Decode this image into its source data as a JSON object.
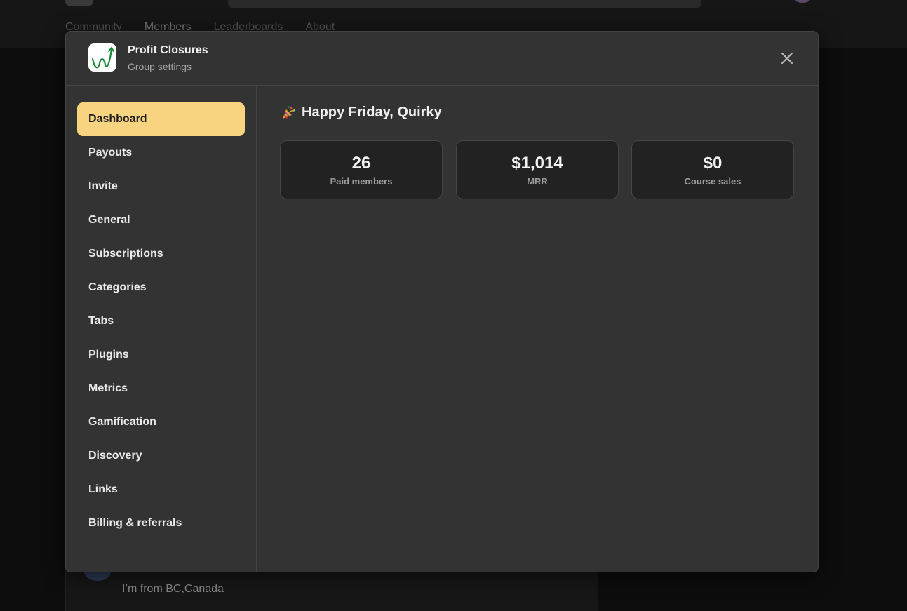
{
  "background": {
    "tabs": [
      "Community",
      "Members",
      "Leaderboards",
      "About"
    ],
    "post_text": "I’m from BC,Canada"
  },
  "modal": {
    "group_name": "Profit Closures",
    "subtitle": "Group settings",
    "close_icon": "close-icon"
  },
  "sidebar": {
    "items": [
      {
        "label": "Dashboard",
        "active": true
      },
      {
        "label": "Payouts"
      },
      {
        "label": "Invite"
      },
      {
        "label": "General"
      },
      {
        "label": "Subscriptions"
      },
      {
        "label": "Categories"
      },
      {
        "label": "Tabs"
      },
      {
        "label": "Plugins"
      },
      {
        "label": "Metrics"
      },
      {
        "label": "Gamification"
      },
      {
        "label": "Discovery"
      },
      {
        "label": "Links"
      },
      {
        "label": "Billing & referrals"
      }
    ]
  },
  "dashboard": {
    "greeting": "Happy Friday, Quirky",
    "greeting_icon": "party-popper-icon",
    "stats": [
      {
        "value": "26",
        "label": "Paid members"
      },
      {
        "value": "$1,014",
        "label": "MRR"
      },
      {
        "value": "$0",
        "label": "Course sales"
      }
    ]
  },
  "colors": {
    "active_nav": "#f8d481",
    "modal_bg": "#333333",
    "card_bg": "#222222"
  }
}
